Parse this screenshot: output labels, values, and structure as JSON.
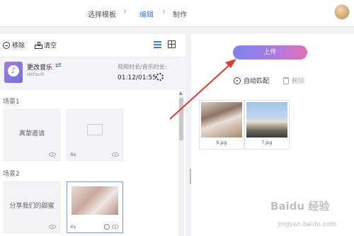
{
  "breadcrumb": {
    "step1": "选择模板",
    "step2": "编辑",
    "step3": "制作"
  },
  "toolbar": {
    "remove": "移除",
    "clear": "清空"
  },
  "music": {
    "name": "更改音乐",
    "sub": "default",
    "duration_label": "视频时长/音乐时长:",
    "duration_value": "01:12/01:55"
  },
  "scenes": [
    {
      "label": "场景1",
      "cards": [
        {
          "text": "真挚邀请"
        },
        {
          "text": "",
          "duration": "4s"
        }
      ]
    },
    {
      "label": "场景2",
      "cards": [
        {
          "text": "分享我们的甜蜜"
        },
        {
          "text": "",
          "duration": "4s"
        }
      ]
    }
  ],
  "upload": {
    "button": "上传",
    "auto_match": "自动匹配",
    "delete": "删除"
  },
  "uploaded": [
    {
      "name": "6.jpg"
    },
    {
      "name": "7.jpg"
    }
  ],
  "watermark": {
    "main": "Baidu 经验",
    "sub": "jingyan.baidu.com"
  },
  "colors": {
    "accent": "#3f7ae8",
    "upload_gradient_start": "#7f84ef",
    "upload_gradient_end": "#e66fb9",
    "annotation_arrow": "#e8362a"
  }
}
